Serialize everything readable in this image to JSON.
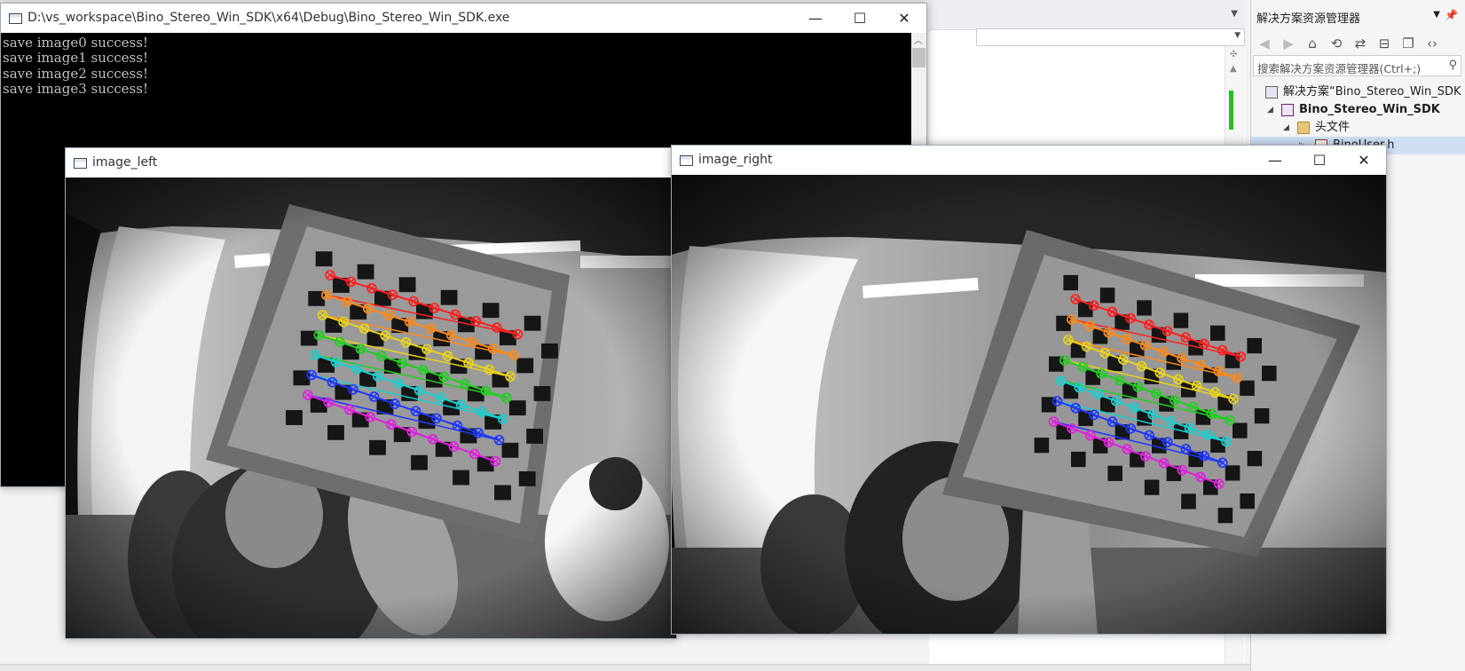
{
  "ide": {
    "explorer_title": "解决方案资源管理器",
    "search_placeholder": "搜索解决方案资源管理器(Ctrl+;)",
    "tree": [
      {
        "label": "解决方案“Bino_Stereo_Win_SDK",
        "bold": false
      },
      {
        "label": "Bino_Stereo_Win_SDK",
        "bold": true
      },
      {
        "label": "头文件",
        "bold": false
      },
      {
        "label": "BinoUser.h",
        "bold": false
      }
    ]
  },
  "console": {
    "title": "D:\\vs_workspace\\Bino_Stereo_Win_SDK\\x64\\Debug\\Bino_Stereo_Win_SDK.exe",
    "lines": [
      "save image0 success!",
      "save image1 success!",
      "save image2 success!",
      "save image3 success!"
    ]
  },
  "left_window": {
    "title": "image_left"
  },
  "right_window": {
    "title": "image_right"
  },
  "icons": {
    "minimize": "minimize-icon",
    "maximize": "maximize-icon",
    "close": "close-icon"
  },
  "colors": {
    "console_bg": "#000000",
    "console_text": "#c0c0c0",
    "corner_rows": [
      "#ff2020",
      "#ff8a1a",
      "#e8d21c",
      "#20d020",
      "#18cfcf",
      "#2038ff",
      "#e020e0"
    ]
  }
}
